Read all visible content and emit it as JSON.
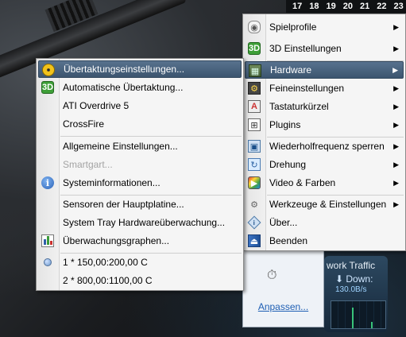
{
  "taskbar": {
    "clock_hours": [
      "17",
      "18",
      "19",
      "20",
      "21",
      "22",
      "23"
    ]
  },
  "tray_window": {
    "customize_label": "Anpassen..."
  },
  "network_gadget": {
    "title": "work Traffic",
    "down_label": "Down:",
    "rate": "130.0B/s"
  },
  "main_menu": {
    "items": [
      {
        "label": "Spielprofile",
        "icon": "gamepad-icon",
        "submenu": true
      },
      {
        "label": "3D Einstellungen",
        "icon": "3d-icon",
        "submenu": true
      },
      {
        "label": "Hardware",
        "icon": "hardware-icon",
        "submenu": true,
        "highlighted": true
      },
      {
        "label": "Feineinstellungen",
        "icon": "fine-tuning-icon",
        "submenu": true
      },
      {
        "label": "Tastaturkürzel",
        "icon": "keyboard-shortcut-icon",
        "submenu": true
      },
      {
        "label": "Plugins",
        "icon": "plugin-icon",
        "submenu": true
      },
      {
        "label": "Wiederholfrequenz sperren",
        "icon": "refresh-lock-icon",
        "submenu": true
      },
      {
        "label": "Drehung",
        "icon": "rotation-icon",
        "submenu": true
      },
      {
        "label": "Video & Farben",
        "icon": "video-color-icon",
        "submenu": true
      },
      {
        "label": "Werkzeuge & Einstellungen",
        "icon": "tools-gear-icon",
        "submenu": true
      },
      {
        "label": "Über...",
        "icon": "about-icon",
        "submenu": false
      },
      {
        "label": "Beenden",
        "icon": "exit-icon",
        "submenu": false
      }
    ]
  },
  "hardware_submenu": {
    "items": [
      {
        "label": "Übertaktungseinstellungen...",
        "icon": "overclock-icon",
        "highlighted": true
      },
      {
        "label": "Automatische Übertaktung...",
        "icon": "3d-icon"
      },
      {
        "label": "ATI Overdrive 5"
      },
      {
        "label": "CrossFire"
      },
      {
        "label": "Allgemeine Einstellungen..."
      },
      {
        "label": "Smartgart...",
        "disabled": true
      },
      {
        "label": "Systeminformationen...",
        "icon": "info-icon"
      },
      {
        "label": "Sensoren der Hauptplatine..."
      },
      {
        "label": "System Tray Hardwareüberwachung..."
      },
      {
        "label": "Überwachungsgraphen...",
        "icon": "chart-icon"
      },
      {
        "label": "1 * 150,00:200,00 C",
        "icon": "dot-icon"
      },
      {
        "label": "2 * 800,00:1100,00 C"
      }
    ]
  },
  "colors": {
    "highlight": "#4a6580",
    "menu_bg": "#f5f5f5",
    "disabled_text": "#a3a3a3"
  }
}
